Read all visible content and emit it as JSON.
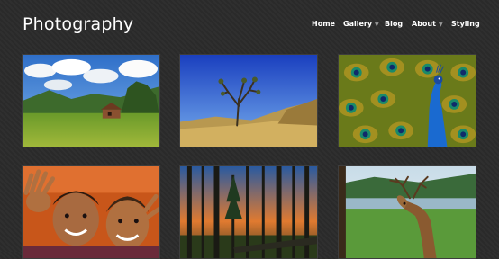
{
  "site": {
    "title": "Photography"
  },
  "nav": {
    "items": [
      {
        "label": "Home",
        "has_dropdown": false
      },
      {
        "label": "Gallery",
        "has_dropdown": true
      },
      {
        "label": "Blog",
        "has_dropdown": false
      },
      {
        "label": "About",
        "has_dropdown": true
      },
      {
        "label": "Styling",
        "has_dropdown": false
      }
    ],
    "dropdown_icon": "chevron-down-icon"
  },
  "gallery": {
    "photos": [
      {
        "subject": "alpine meadow with cabin"
      },
      {
        "subject": "joshua tree in desert"
      },
      {
        "subject": "peacock with open tail"
      },
      {
        "subject": "smiling children"
      },
      {
        "subject": "forest at sunset"
      },
      {
        "subject": "deer by a lake"
      }
    ]
  }
}
